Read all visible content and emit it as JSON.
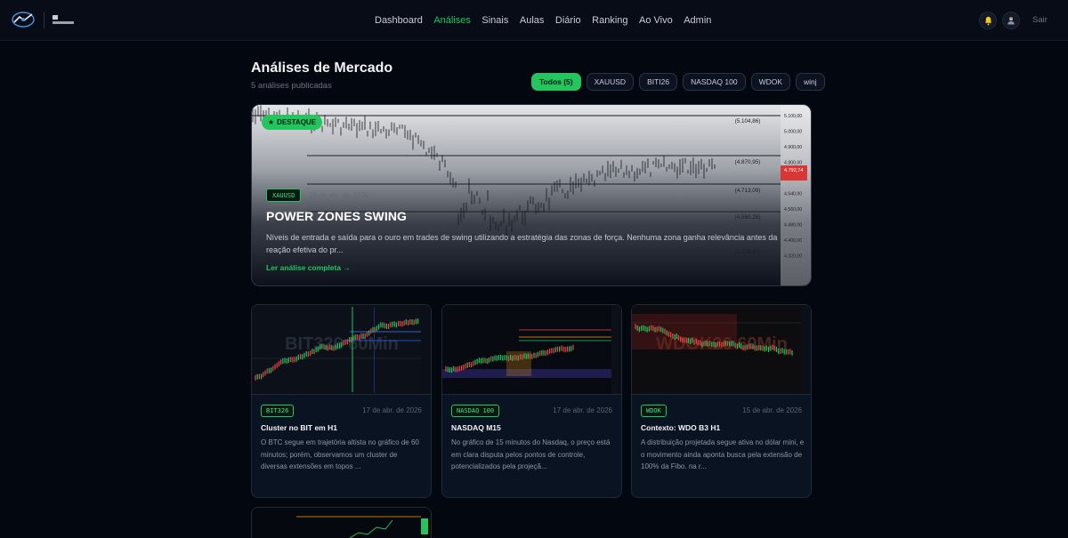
{
  "nav": {
    "links": [
      "Dashboard",
      "Análises",
      "Sinais",
      "Aulas",
      "Diário",
      "Ranking",
      "Ao Vivo",
      "Admin"
    ],
    "active_index": 1,
    "logout_label": "Sair",
    "accent": "#22c55e"
  },
  "header": {
    "title": "Análises de Mercado",
    "subtitle": "5 análises publicadas"
  },
  "filters": [
    {
      "label": "Todos (5)",
      "active": true
    },
    {
      "label": "XAUUSD",
      "active": false
    },
    {
      "label": "BITI26",
      "active": false
    },
    {
      "label": "NASDAQ 100",
      "active": false
    },
    {
      "label": "WDOK",
      "active": false
    },
    {
      "label": "winj",
      "active": false
    }
  ],
  "featured": {
    "badge": "DESTAQUE",
    "tag": "XAUUSD",
    "date": "23 de abr. de 2026",
    "title": "POWER ZONES SWING",
    "description": "Níveis de entrada e saída para o ouro em trades de swing utilizando a estratégia das zonas de força. Nenhuma zona ganha relevância antes da reação efetiva do pr...",
    "link": "Ler análise completa →",
    "chart_levels": [
      "(5.104,86)",
      "(4.870,95)",
      "(4.713,09)",
      "(4.560,35)",
      "(4.378,30)"
    ],
    "axis_labels": [
      "5.100,00",
      "5.000,00",
      "4.900,00",
      "4.800,00",
      "4.720,00",
      "4.640,00",
      "4.560,00",
      "4.480,00",
      "4.400,00",
      "4.320,00"
    ],
    "price_tag": "4.792,74"
  },
  "cards": [
    {
      "tag": "BIT326",
      "date": "17 de abr. de 2026",
      "title": "Cluster no BIT em H1",
      "description": "O BTC segue em trajetória altista no gráfico de 60 minutos; porém, observamos um cluster de diversas extensões em topos ...",
      "watermark": "BIT326 60Min"
    },
    {
      "tag": "NASDAQ 100",
      "date": "17 de abr. de 2026",
      "title": "NASDAQ M15",
      "description": "No gráfico de 15 minutos do Nasdaq, o preço está em clara disputa pelos pontos de controle, potencializados pela projeçã...",
      "watermark": ""
    },
    {
      "tag": "WDOK",
      "date": "15 de abr. de 2026",
      "title": "Contexto: WDO B3 H1",
      "description": "A distribuição projetada segue ativa no dólar mini, e o movimento ainda aponta busca pela extensão de 100% da Fibo. na r...",
      "watermark": "WDOK26 60Min"
    }
  ]
}
